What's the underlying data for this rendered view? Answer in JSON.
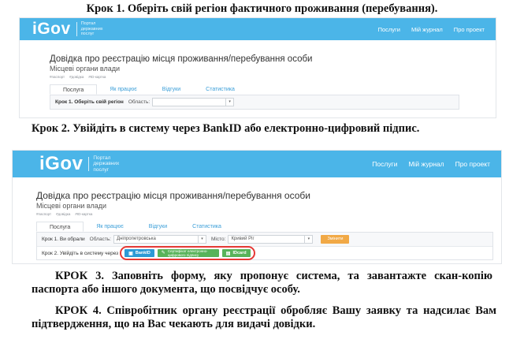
{
  "steps": {
    "step1": "Крок 1. Оберіть свій регіон фактичного проживання (перебування).",
    "step2": "Крок 2. Увійдіть в систему через BankID або електронно-цифровий підпис.",
    "step3": "КРОК 3. Заповніть форму, яку пропонує система, та завантажте скан-копію паспорта або іншого документа, що посвідчує особу.",
    "step4": "КРОК 4. Співробітник органу реєстрації обробляє Вашу заявку та надсилає Вам підтвердження, що на Вас чекають для видачі довідки."
  },
  "header": {
    "logo": "iGov",
    "logo_sub": "Портал державних послуг",
    "nav": [
      "Послуги",
      "Мій журнал",
      "Про проект"
    ]
  },
  "service": {
    "title": "Довідка про реєстрацію місця проживання/перебування особи",
    "subtitle": "Місцеві органи влади",
    "tags": [
      "#паспорт",
      "#довідка",
      "#ID-картка"
    ]
  },
  "tabs": [
    "Послуга",
    "Як працює",
    "Відгуки",
    "Статистика"
  ],
  "screen1": {
    "step_label": "Крок 1. Оберіть свій регіон",
    "region_label": "Область:",
    "region_value": "",
    "arrow": "▾"
  },
  "screen2": {
    "step1_label": "Крок 1. Ви обрали",
    "region_label": "Область:",
    "region_value": "Дніпропетровська",
    "city_label": "Місто:",
    "city_value": "Кривий Ріг",
    "change_button": "Змінити",
    "step2_label": "Крок 2. Увійдіть в систему через",
    "bankid_button": "BankID",
    "cert_button": "Сертифікат електронно-цифрового підпису",
    "idcard_button": "IDcard",
    "arrow": "▾"
  },
  "icons": {
    "bankid": "bankid-icon",
    "cert": "certificate-icon",
    "idcard": "idcard-icon"
  },
  "colors": {
    "header": "#4bb5e8",
    "link": "#3a9ed8",
    "change_button": "#f1a946",
    "bankid_button": "#2c9ad5",
    "green_button": "#58b35a",
    "highlight": "#e53935"
  }
}
